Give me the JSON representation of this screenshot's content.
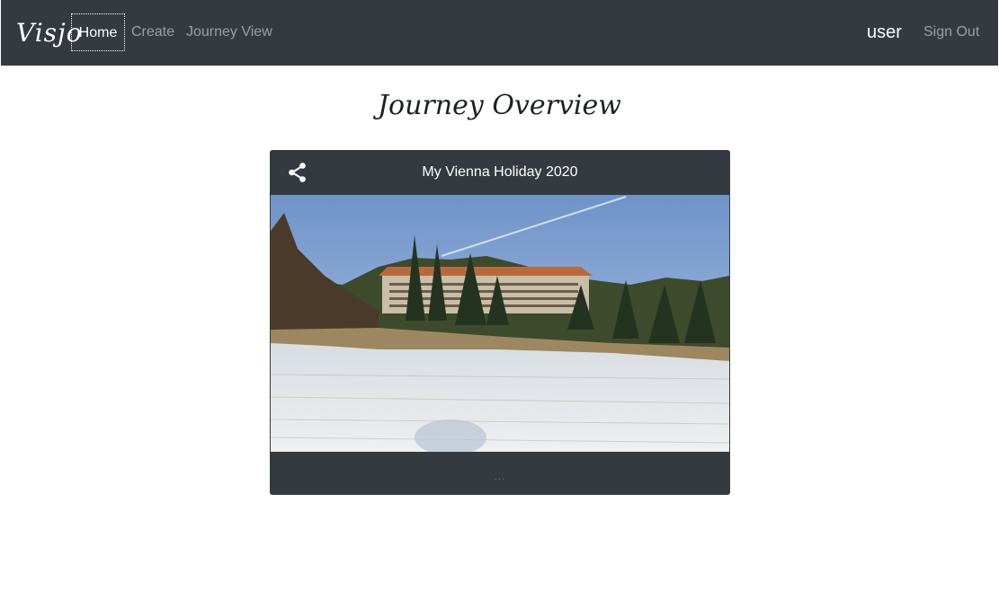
{
  "navbar": {
    "brand": "Visjo",
    "links": [
      {
        "label": "Home",
        "active": true
      },
      {
        "label": "Create",
        "active": false
      },
      {
        "label": "Journey View",
        "active": false
      }
    ],
    "user": "user",
    "sign_out": "Sign Out"
  },
  "page": {
    "title": "Journey Overview"
  },
  "journeys": [
    {
      "title": "My Vienna Holiday 2020",
      "share_icon": "share-icon",
      "more": "..."
    }
  ],
  "colors": {
    "navbar_bg": "#343a40",
    "card_bg": "#343a40",
    "active_text": "#ffffff",
    "inactive_text": "rgba(255,255,255,0.5)"
  }
}
